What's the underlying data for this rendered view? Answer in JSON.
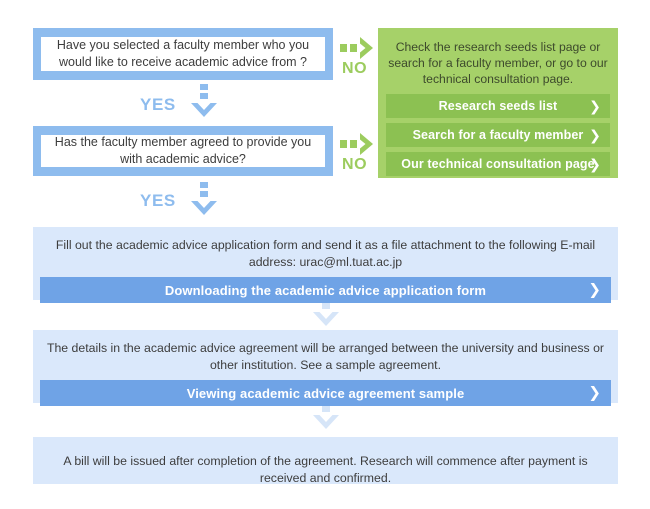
{
  "flow": {
    "decision1": {
      "text": "Have you selected a faculty member who you would like to receive academic advice from ?",
      "yes_label": "YES",
      "no_label": "NO"
    },
    "decision2": {
      "text": "Has the faculty member agreed to provide you with academic advice?",
      "yes_label": "YES",
      "no_label": "NO"
    },
    "branch_panel": {
      "text": "Check the research seeds list page or search for a faculty member, or go to our technical consultation page.",
      "buttons": [
        {
          "label": "Research seeds list",
          "chevron": "❯"
        },
        {
          "label": "Search for a faculty member",
          "chevron": "❯"
        },
        {
          "label": "Our technical consultation page",
          "chevron": "❯"
        }
      ]
    },
    "step1": {
      "text": "Fill out the academic advice application form and send it as a file attachment to the following E-mail address: urac@ml.tuat.ac.jp",
      "button": {
        "label": "Downloading the academic advice application form",
        "chevron": "❯"
      }
    },
    "step2": {
      "text": "The details in the academic advice agreement will be arranged between the university and business or other institution. See a sample agreement.",
      "button": {
        "label": "Viewing academic advice agreement sample",
        "chevron": "❯"
      }
    },
    "step3": {
      "text": "A bill will be issued after completion of the agreement. Research will commence after payment is received and confirmed."
    }
  },
  "colors": {
    "blue_frame": "#8ebcee",
    "blue_band": "#dae8fb",
    "blue_button": "#6fa3e6",
    "green_panel": "#a6d169",
    "green_button": "#8cc152",
    "arrow_blue": "#8ebcee",
    "arrow_green": "#9ccc5e",
    "arrow_pale": "#d6e5f8",
    "text": "#3d3d3d"
  }
}
